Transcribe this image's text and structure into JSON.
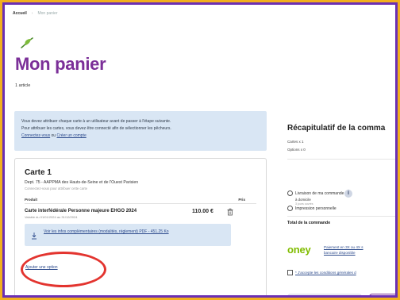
{
  "breadcrumb": {
    "home": "Accueil",
    "current": "Mon panier"
  },
  "page": {
    "title": "Mon panier",
    "item_count": "1 article"
  },
  "info_box": {
    "line1": "Vous devez attribuer chaque carte à un utilisateur avant de passer à l'étape suivante.",
    "line2": "Pour attribuer les cartes, vous devez être connecté afin de sélectionner les pêcheurs.",
    "login_link": "Connectez-vous",
    "or_text": " ou ",
    "create_link": "Créer un compte"
  },
  "card": {
    "title": "Carte 1",
    "department": "Dept. 75 - AAPPMA des Hauts-de-Seine et de l'Ouest Parisien",
    "connect_hint": "Connectez-vous pour attribuer cette carte",
    "col_product": "Produit",
    "col_price": "Prix",
    "product_name": "Carte interfédérale Personne majeure EHGO 2024",
    "price": "110.00 €",
    "validity": "Valable du 01/01/2024 au 31/12/2024",
    "more_info": "Voir les infos complémentaires (modalités, règlement) PDF - 451.25 Ko",
    "add_option": "Ajouter une option"
  },
  "summary": {
    "title": "Récapitulatif de la comma",
    "cards_line": "Cartes x 1",
    "options_line": "Options x 0",
    "delivery_option": "Livraison de ma commande",
    "delivery_sub": "à domicile",
    "delivery_note": "3 jours ouvrés",
    "print_option": "Impression personnelle",
    "total_label": "Total de la commande",
    "oney_logo": "oney",
    "oney_line1": "Paiement en 3X ou 4X s",
    "oney_line2": "bancaire disponible",
    "terms": "* J'accepte les conditions générales d"
  },
  "colors": {
    "frame": "#6b2fb3",
    "border_bg": "#f2b01e",
    "title": "#7b2f98",
    "highlight": "#e3342f",
    "oney": "#80bc00",
    "info_bg": "#d9e6f4"
  },
  "icons": {
    "leaf": "leaf-icon",
    "trash": "trash-icon",
    "download": "download-icon",
    "info": "info-icon"
  }
}
